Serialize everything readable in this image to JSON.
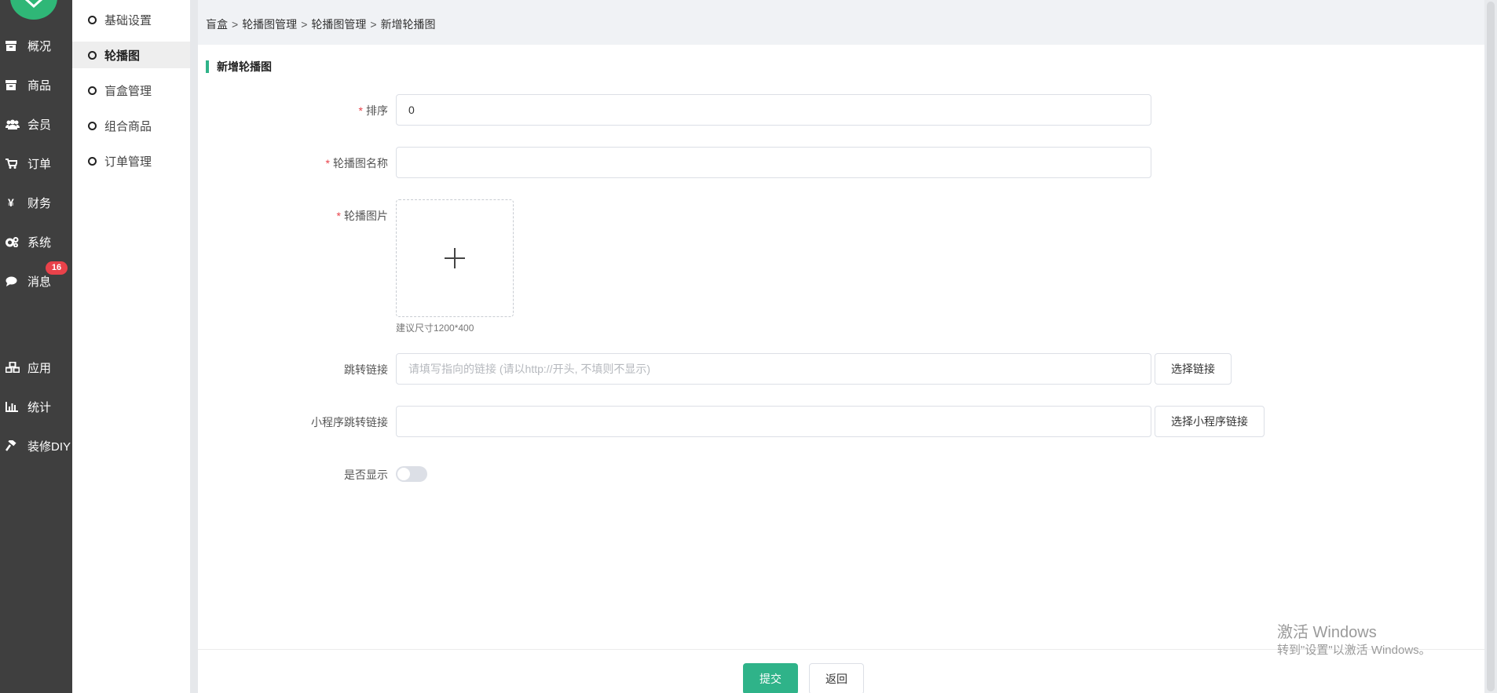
{
  "sidebar": {
    "items": [
      {
        "label": "概况",
        "icon": "box-icon"
      },
      {
        "label": "商品",
        "icon": "box-icon"
      },
      {
        "label": "会员",
        "icon": "users-icon"
      },
      {
        "label": "订单",
        "icon": "cart-icon"
      },
      {
        "label": "财务",
        "icon": "yen-icon"
      },
      {
        "label": "系统",
        "icon": "gears-icon"
      },
      {
        "label": "消息",
        "icon": "chat-icon"
      },
      {
        "label": "应用",
        "icon": "cubes-icon"
      },
      {
        "label": "统计",
        "icon": "bar-chart-icon"
      },
      {
        "label": "装修DIY",
        "icon": "hammer-icon"
      }
    ],
    "message_badge": "16",
    "accent_color": "#2fb777"
  },
  "submenu": {
    "items": [
      {
        "label": "基础设置",
        "active": false
      },
      {
        "label": "轮播图",
        "active": true
      },
      {
        "label": "盲盒管理",
        "active": false
      },
      {
        "label": "组合商品",
        "active": false
      },
      {
        "label": "订单管理",
        "active": false
      }
    ]
  },
  "breadcrumb": [
    "盲盒",
    "轮播图管理",
    "轮播图管理",
    "新增轮播图"
  ],
  "breadcrumb_separator": ">",
  "form": {
    "title": "新增轮播图",
    "required_mark": "*",
    "sort": {
      "label": "排序",
      "value": "0"
    },
    "name": {
      "label": "轮播图名称",
      "value": ""
    },
    "image": {
      "label": "轮播图片",
      "hint": "建议尺寸1200*400"
    },
    "link": {
      "label": "跳转链接",
      "placeholder": "请填写指向的链接 (请以http://开头, 不填则不显示)",
      "button": "选择链接"
    },
    "mini_link": {
      "label": "小程序跳转链接",
      "value": "",
      "button": "选择小程序链接"
    },
    "show": {
      "label": "是否显示",
      "enabled": false
    },
    "submit": "提交",
    "back": "返回"
  },
  "watermark": {
    "line1": "激活 Windows",
    "line2": "转到\"设置\"以激活 Windows。"
  },
  "colors": {
    "primary": "#2fb389",
    "danger": "#e9424a",
    "sidebar_bg": "#3f3f3f"
  }
}
